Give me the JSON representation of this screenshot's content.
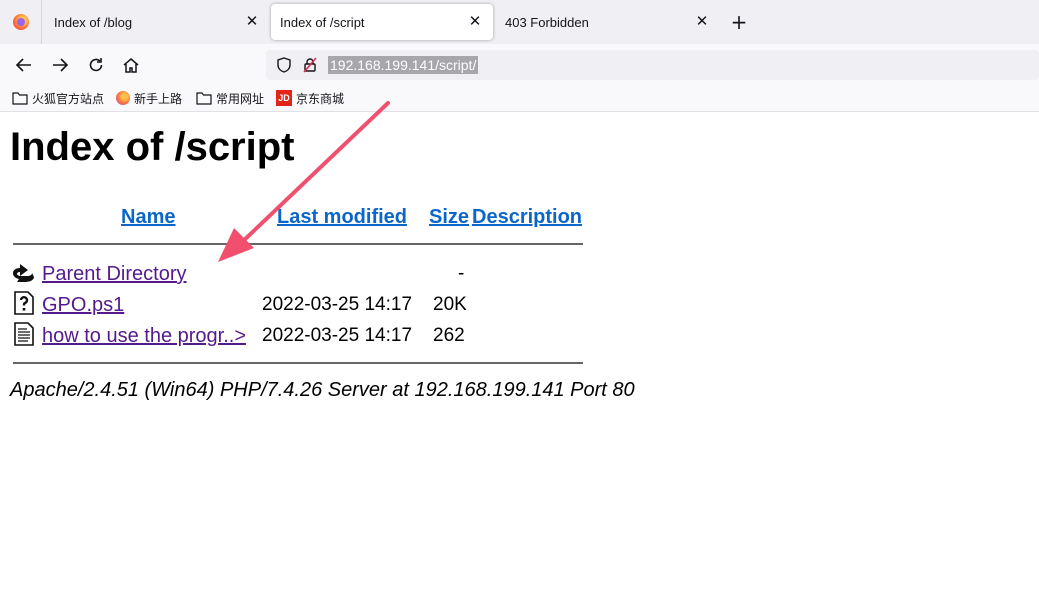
{
  "browser": {
    "tabs": [
      {
        "label": "Index of /blog",
        "active": false
      },
      {
        "label": "Index of /script",
        "active": true
      },
      {
        "label": "403 Forbidden",
        "active": false
      }
    ],
    "url": "192.168.199.141/script/",
    "bookmarks": [
      {
        "label": "火狐官方站点",
        "icon": "folder-icon"
      },
      {
        "label": "新手上路",
        "icon": "firefox-icon"
      },
      {
        "label": "常用网址",
        "icon": "folder-icon"
      },
      {
        "label": "京东商城",
        "icon": "jd-icon",
        "badge": "JD"
      }
    ]
  },
  "page": {
    "title": "Index of /script",
    "columns": {
      "name": "Name",
      "last_modified": "Last modified",
      "size": "Size",
      "description": "Description"
    },
    "rows": [
      {
        "name": "Parent Directory",
        "date": "",
        "size": "-",
        "icon": "back-icon"
      },
      {
        "name": "GPO.ps1",
        "date": "2022-03-25 14:17",
        "size": "20K",
        "icon": "unknown-file-icon"
      },
      {
        "name": "how to use the progr..>",
        "date": "2022-03-25 14:17",
        "size": "262",
        "icon": "text-file-icon"
      }
    ],
    "address": "Apache/2.4.51 (Win64) PHP/7.4.26 Server at 192.168.199.141 Port 80"
  },
  "annotation": {
    "arrow_color": "#f0506e"
  },
  "colors": {
    "link": "#0b66c9",
    "visited": "#551a8b",
    "tabstrip": "#f0f0f4"
  }
}
